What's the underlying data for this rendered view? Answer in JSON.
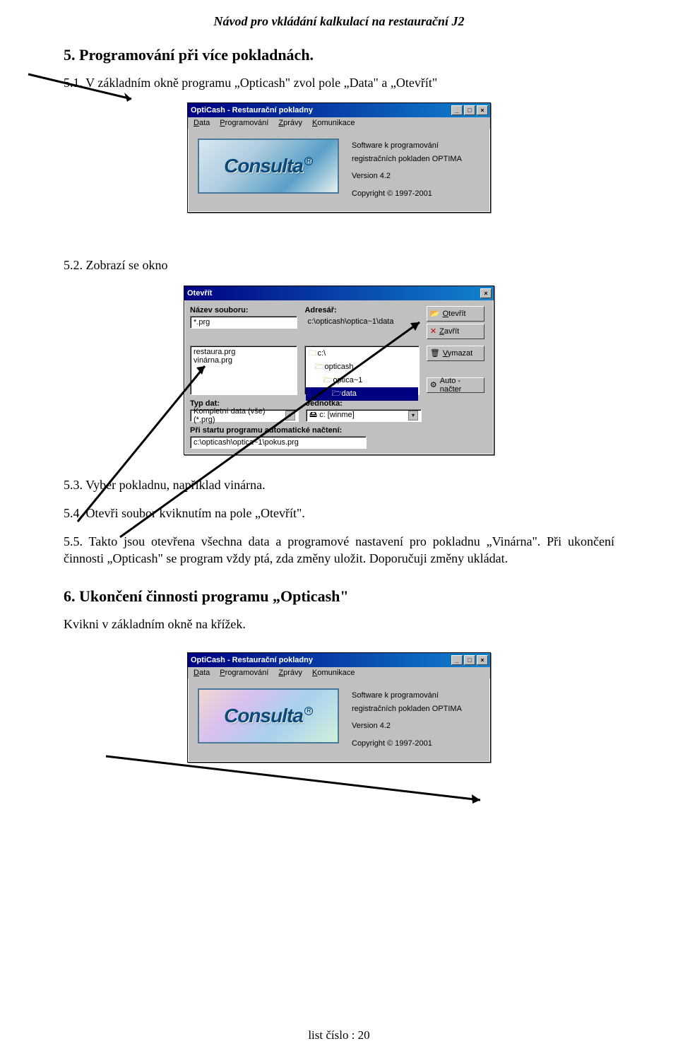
{
  "header": "Návod pro vkládání kalkulací na restaurační J2",
  "section5": {
    "heading": "5. Programování při více pokladnách.",
    "p1": "5.1. V základním okně programu „Opticash\" zvol pole „Data\" a „Otevřít\"",
    "p2": "5.2. Zobrazí se okno",
    "p3": "5.3. Vyber pokladnu, například vinárna.",
    "p4": "5.4. Otevři soubor kviknutím na pole „Otevřít\".",
    "p5": "5.5. Takto jsou otevřena všechna data a programové nastavení pro pokladnu „Vinárna\". Při ukončení činnosti „Opticash\" se program vždy ptá, zda změny uložit. Doporučuji změny ukládat."
  },
  "section6": {
    "heading": "6. Ukončení činnosti programu „Opticash\"",
    "p1": "Kvikni v základním okně na křížek."
  },
  "footer": "list číslo :   20",
  "scr_main": {
    "title": "OptiCash - Restaurační pokladny",
    "menu": [
      "Data",
      "Programování",
      "Zprávy",
      "Komunikace"
    ],
    "logo": "Consulta",
    "info": {
      "l1": "Software k programování",
      "l2": "registračních pokladen OPTIMA",
      "ver": "Version 4.2",
      "cpr": "Copyright © 1997-2001"
    }
  },
  "scr_open": {
    "title": "Otevřít",
    "name_lbl": "Název souboru:",
    "name_val": "*.prg",
    "dir_lbl": "Adresář:",
    "dir_val": "c:\\opticash\\optica~1\\data",
    "files": [
      "restaura.prg",
      "vinárna.prg"
    ],
    "folders": [
      "c:\\",
      "opticash",
      "optica~1",
      "data"
    ],
    "btn_open": "Otevřít",
    "btn_close": "Zavřít",
    "btn_del": "Vymazat",
    "btn_auto": "Auto - načter",
    "type_lbl": "Typ dat:",
    "type_val": "Kompletní data (vše)(*.prg)",
    "drive_lbl": "Jednotka:",
    "drive_val": "c: [winme]",
    "autoload_lbl": "Při startu programu automatické načtení:",
    "autoload_val": "c:\\opticash\\optica~1\\pokus.prg"
  }
}
